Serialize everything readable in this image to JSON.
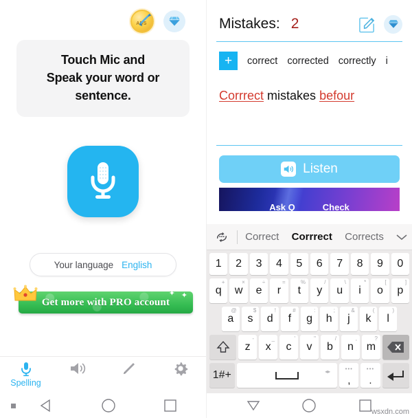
{
  "left": {
    "topbar": {
      "ads_icon": "ads-coin-icon",
      "ads_label": "ADS",
      "gem_icon": "diamond-icon"
    },
    "instruction": {
      "line1": "Touch Mic and",
      "line2": "Speak your word or",
      "line3": "sentence."
    },
    "mic_button": {
      "icon": "microphone-icon",
      "color": "#24b5f0"
    },
    "language": {
      "label": "Your language",
      "value": "English"
    },
    "pro_banner": {
      "text": "Get more with PRO account",
      "crown_icon": "crown-icon",
      "color": "#36bd53"
    },
    "tabs": [
      {
        "icon": "microphone-icon",
        "label": "Spelling",
        "active": true
      },
      {
        "icon": "speaker-icon",
        "label": "",
        "active": false
      },
      {
        "icon": "pencil-icon",
        "label": "",
        "active": false
      },
      {
        "icon": "gear-icon",
        "label": "",
        "active": false
      }
    ],
    "navbar": {
      "dot": "square-dot-icon",
      "back": "back-triangle-icon",
      "home": "home-circle-icon",
      "recents": "recents-square-icon"
    }
  },
  "right": {
    "header": {
      "title": "Mistakes:",
      "count": "2",
      "count_color": "#a5201b",
      "edit_icon": "edit-pencil-square-icon",
      "gem_icon": "diamond-icon"
    },
    "suggestions": {
      "add_label": "+",
      "words": [
        "correct",
        "corrected",
        "correctly",
        "i"
      ]
    },
    "sentence": {
      "parts": [
        {
          "text": "Corrrect",
          "error": true
        },
        {
          "text": " mistakes ",
          "error": false
        },
        {
          "text": "befour",
          "error": true
        }
      ],
      "word1": "Corrrect",
      "word2": "mistakes",
      "word3": "befour"
    },
    "listen_button": {
      "label": "Listen",
      "icon": "speaker-icon",
      "color": "#6fd0f7"
    },
    "promo_banner": {
      "text_left": "Ask Q",
      "text_right": "Check"
    },
    "keyboard": {
      "refresh_icon": "refresh-arrows-icon",
      "candidates": [
        {
          "text": "Correct",
          "active": false
        },
        {
          "text": "Corrrect",
          "active": true
        },
        {
          "text": "Corrects",
          "active": false
        }
      ],
      "chevron_icon": "chevron-down-icon",
      "row_numbers": [
        "1",
        "2",
        "3",
        "4",
        "5",
        "6",
        "7",
        "8",
        "9",
        "0"
      ],
      "row_q": [
        {
          "main": "q",
          "sup": "+"
        },
        {
          "main": "w",
          "sup": "×"
        },
        {
          "main": "e",
          "sup": "÷"
        },
        {
          "main": "r",
          "sup": "="
        },
        {
          "main": "t",
          "sup": "%"
        },
        {
          "main": "y",
          "sup": "/"
        },
        {
          "main": "u",
          "sup": "\\"
        },
        {
          "main": "i",
          "sup": "*"
        },
        {
          "main": "o",
          "sup": "["
        },
        {
          "main": "p",
          "sup": "]"
        }
      ],
      "row_a": [
        {
          "main": "a",
          "sup": "@"
        },
        {
          "main": "s",
          "sup": "$"
        },
        {
          "main": "d",
          "sup": "!"
        },
        {
          "main": "f",
          "sup": "#"
        },
        {
          "main": "g",
          "sup": ":"
        },
        {
          "main": "h",
          "sup": ";"
        },
        {
          "main": "j",
          "sup": "&"
        },
        {
          "main": "k",
          "sup": "("
        },
        {
          "main": "l",
          "sup": ")"
        }
      ],
      "row_z": [
        {
          "main": "z",
          "sup": "-"
        },
        {
          "main": "x",
          "sup": "_"
        },
        {
          "main": "c",
          "sup": "'"
        },
        {
          "main": "v",
          "sup": "\""
        },
        {
          "main": "b",
          "sup": "/"
        },
        {
          "main": "n",
          "sup": ","
        },
        {
          "main": "m",
          "sup": "?"
        }
      ],
      "shift_icon": "shift-arrow-icon",
      "backspace_icon": "backspace-icon",
      "symbols_key": "1#+",
      "space_key": "space-bar",
      "comma_key": ",",
      "period_key": ".",
      "enter_icon": "enter-return-icon"
    },
    "navbar": {
      "hide": "hide-keyboard-triangle-icon",
      "home": "home-circle-icon",
      "recents": "recents-square-icon"
    }
  },
  "watermark": "wsxdn.com"
}
